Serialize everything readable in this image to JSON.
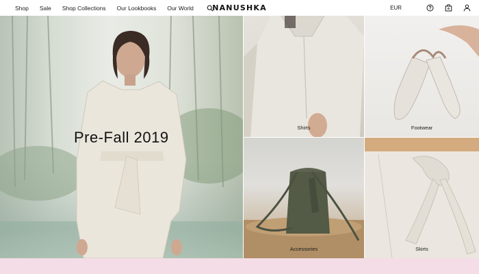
{
  "header": {
    "nav": [
      "Shop",
      "Sale",
      "Shop Collections",
      "Our Lookbooks",
      "Our World"
    ],
    "logo": "NANUSHKA",
    "currency": "EUR",
    "icons": [
      "search-icon",
      "help-icon",
      "bag-icon",
      "account-icon"
    ]
  },
  "hero": {
    "title": "Pre-Fall 2019"
  },
  "tiles": [
    {
      "label": "Shirts"
    },
    {
      "label": "Footwear"
    },
    {
      "label": "Accessories"
    },
    {
      "label": "Skirts"
    }
  ],
  "colors": {
    "bottom_band": "#f4dde6",
    "text": "#1a1a1a"
  }
}
